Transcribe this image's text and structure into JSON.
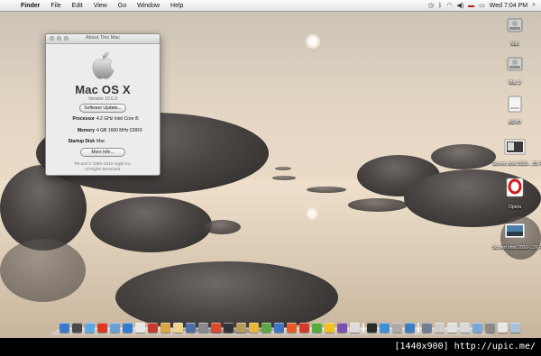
{
  "menubar": {
    "apple_icon": "apple-icon",
    "items": [
      {
        "label": "Finder",
        "bold": true
      },
      {
        "label": "File"
      },
      {
        "label": "Edit"
      },
      {
        "label": "View"
      },
      {
        "label": "Go"
      },
      {
        "label": "Window"
      },
      {
        "label": "Help"
      }
    ],
    "clock": "Wed 7:04 PM"
  },
  "about_window": {
    "title": "About This Mac",
    "os_name": "Mac OS X",
    "version": "Version 10.6.3",
    "software_update_label": "Software Update...",
    "rows": [
      {
        "key": "Processor",
        "value": "4.2 GHz Intel Core i5"
      },
      {
        "key": "Memory",
        "value": "4 GB 1600 MHz DDR3"
      },
      {
        "key": "Startup Disk",
        "value": "Mac"
      }
    ],
    "more_info_label": "More Info...",
    "copyright_1": "TM and © 1983–2010 Apple Inc.",
    "copyright_2": "All Rights Reserved."
  },
  "desktop_icons": [
    {
      "label": "Mac",
      "icon": "hard-drive-icon"
    },
    {
      "label": "Mac 2",
      "icon": "hard-drive-icon"
    },
    {
      "label": "AEVO",
      "icon": "external-drive-icon"
    },
    {
      "label": "Screen shot 2010-...55 PM",
      "icon": "screenshot-file-icon"
    },
    {
      "label": "Opera",
      "icon": "opera-icon"
    },
    {
      "label": "Screen shot 2010-...26 PM",
      "icon": "screenshot-file-icon"
    }
  ],
  "dock_colors": [
    "#3a79c9",
    "#4a4a4a",
    "#5ea7e6",
    "#d9371f",
    "#6a9fd8",
    "#2f7bd1",
    "#e7e7e7",
    "#c43b2e",
    "#d9a441",
    "#f0d28a",
    "#4e6ea5",
    "#888888",
    "#d94a2b",
    "#333333",
    "#b89b5b",
    "#ebb43a",
    "#5ea54a",
    "#3d74c4",
    "#e65a2a",
    "#d33a2a",
    "#56aa3f",
    "#f0c21c",
    "#7a50b0",
    "#dcdcdc",
    "#4b86c8",
    "#2b2b2b",
    "#3e90d4",
    "#aaaaaa",
    "#3c7dc2",
    "#6aa0d9",
    "#6f7f91",
    "#cccccc",
    "#e1e1e1",
    "#d8d8d8",
    "#78a8da",
    "#8a8a8a",
    "#e7e7e7",
    "#a9c1da"
  ],
  "caption": "[1440x900] http://upic.me/"
}
